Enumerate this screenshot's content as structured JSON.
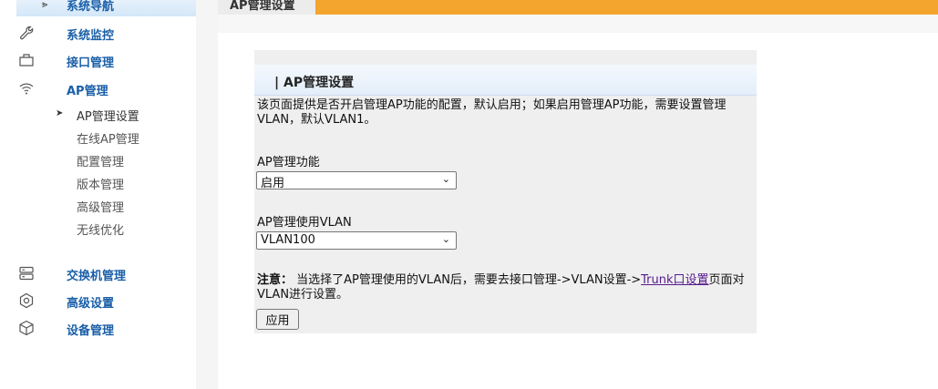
{
  "sidebar": {
    "header": {
      "label": "系统导航"
    },
    "items": [
      {
        "label": "系统监控",
        "icon": "wrench-icon"
      },
      {
        "label": "接口管理",
        "icon": "folder-icon"
      },
      {
        "label": "AP管理",
        "icon": "wifi-icon"
      },
      {
        "label": "交换机管理",
        "icon": "server-icon"
      },
      {
        "label": "高级设置",
        "icon": "hexagon-icon"
      },
      {
        "label": "设备管理",
        "icon": "cube-icon"
      }
    ],
    "sub_items": [
      {
        "label": "AP管理设置"
      },
      {
        "label": "在线AP管理"
      },
      {
        "label": "配置管理"
      },
      {
        "label": "版本管理"
      },
      {
        "label": "高级管理"
      },
      {
        "label": "无线优化"
      }
    ]
  },
  "tab": {
    "label": "AP管理设置"
  },
  "panel": {
    "title": "| AP管理设置",
    "description": "该页面提供是否开启管理AP功能的配置，默认启用；如果启用管理AP功能，需要设置管理VLAN，默认VLAN1。",
    "ap_function": {
      "label": "AP管理功能",
      "value": "启用"
    },
    "ap_vlan": {
      "label": "AP管理使用VLAN",
      "value": "VLAN100"
    },
    "note": {
      "prefix": "注意：",
      "text": " 当选择了AP管理使用的VLAN后，需要去接口管理->VLAN设置->",
      "link": "Trunk口设置",
      "suffix": "页面对VLAN进行设置。"
    },
    "apply_label": "应用"
  },
  "colors": {
    "accent": "#f3a52d",
    "nav_text": "#1a5fa8",
    "link": "#551a8b"
  }
}
